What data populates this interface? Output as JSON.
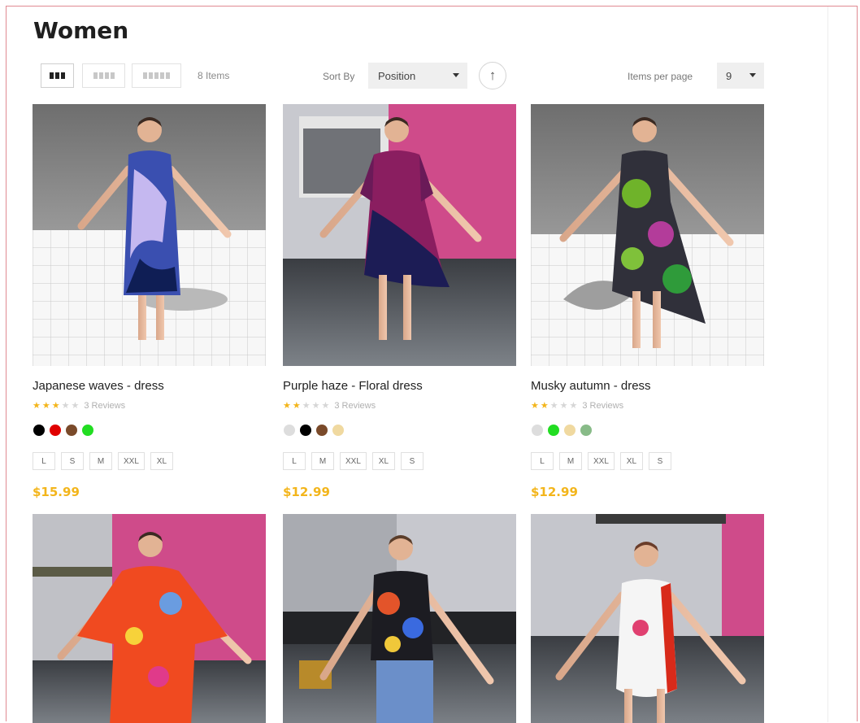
{
  "page": {
    "title": "Women"
  },
  "toolbar": {
    "items_count": "8 Items",
    "sort_label": "Sort By",
    "sort_value": "Position",
    "sort_direction_icon": "arrow-up-icon",
    "per_page_label": "Items per page",
    "per_page_value": "9"
  },
  "products": [
    {
      "name": "Japanese waves - dress",
      "rating": 3,
      "reviews": "3 Reviews",
      "colors": [
        "#000000",
        "#e00000",
        "#7a4a2a",
        "#22dd22"
      ],
      "sizes": [
        "L",
        "S",
        "M",
        "XXL",
        "XL"
      ],
      "price": "$15.99"
    },
    {
      "name": "Purple haze - Floral dress",
      "rating": 2,
      "reviews": "3 Reviews",
      "colors": [
        "#dddddd",
        "#000000",
        "#7a4a2a",
        "#f0d9a0"
      ],
      "sizes": [
        "L",
        "M",
        "XXL",
        "XL",
        "S"
      ],
      "price": "$12.99"
    },
    {
      "name": "Musky autumn - dress",
      "rating": 2,
      "reviews": "3 Reviews",
      "colors": [
        "#dddddd",
        "#22dd22",
        "#f0d9a0",
        "#88bb88"
      ],
      "sizes": [
        "L",
        "M",
        "XXL",
        "XL",
        "S"
      ],
      "price": "$12.99"
    },
    {
      "name": "",
      "rating": 0,
      "reviews": "",
      "colors": [],
      "sizes": [],
      "price": ""
    },
    {
      "name": "",
      "rating": 0,
      "reviews": "",
      "colors": [],
      "sizes": [],
      "price": ""
    },
    {
      "name": "",
      "rating": 0,
      "reviews": "",
      "colors": [],
      "sizes": [],
      "price": ""
    }
  ]
}
